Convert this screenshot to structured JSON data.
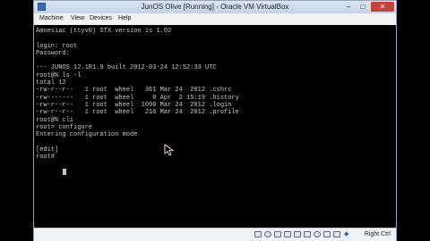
{
  "window": {
    "title": "JunOS Olive [Running] - Oracle VM VirtualBox",
    "controls": {
      "minimize": "–",
      "maximize": "□",
      "close": "✕"
    }
  },
  "menu": [
    "Machine",
    "View",
    "Devices",
    "Help"
  ],
  "terminal": {
    "lines": [
      "Amnesiac (ttyv0) STX version is 1.02",
      "",
      "login: root",
      "Password:",
      "",
      "--- JUNOS 12.1R1.9 built 2012-03-24 12:52:33 UTC",
      "root@% ls -l",
      "total 12",
      "-rw-r--r--   1 root  wheel   361 Mar 24  2012 .cshrc",
      "-rw-------   1 root  wheel     0 Apr  2 15:19 .history",
      "-rw-r--r--   1 root  wheel  1090 Mar 24  2012 .login",
      "-rw-r--r--   1 root  wheel   216 Mar 24  2012 .profile",
      "root@% cli",
      "root> configure",
      "Entering configuration mode",
      "",
      "[edit]",
      "root# "
    ]
  },
  "status": {
    "host_key": "Right Ctrl"
  },
  "icons": [
    "hdd-icon",
    "cd-icon",
    "usb-icon",
    "network-icon",
    "shared-folder-icon",
    "display-icon",
    "capture-icon",
    "mouse-integration-icon",
    "keyboard-icon"
  ]
}
